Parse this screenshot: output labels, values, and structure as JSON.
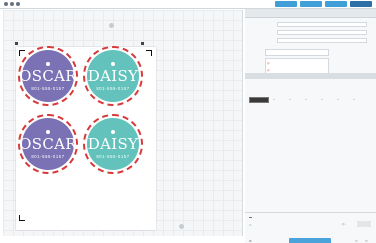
{
  "toolbar": {
    "tabs": [
      "",
      "",
      "",
      ""
    ]
  },
  "panel": {
    "tabs": [
      "",
      "",
      "",
      ""
    ],
    "rows": [
      {
        "label": "",
        "value": ""
      },
      {
        "label": "",
        "value": ""
      },
      {
        "label": "",
        "value": ""
      }
    ],
    "section_title": "",
    "send_label": ""
  },
  "tags": [
    {
      "name": "OSCAR",
      "phone": "801-555-0157",
      "color": "#7b72b5"
    },
    {
      "name": "DAISY",
      "phone": "801-555-0157",
      "color": "#63c2bb"
    },
    {
      "name": "OSCAR",
      "phone": "801-555-0157",
      "color": "#7b72b5"
    },
    {
      "name": "DAISY",
      "phone": "801-555-0157",
      "color": "#63c2bb"
    }
  ],
  "colors": {
    "cut_line": "#d83a3a",
    "accent": "#4ba3dc"
  }
}
